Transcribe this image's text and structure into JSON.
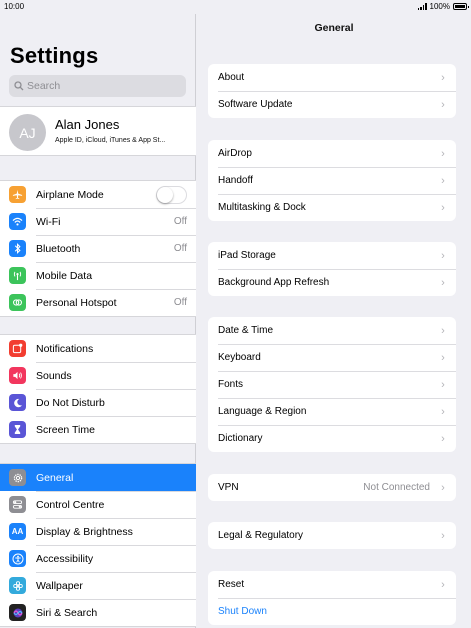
{
  "status": {
    "time": "10:00",
    "battery": "100%"
  },
  "sidebar": {
    "title": "Settings",
    "search_placeholder": "Search",
    "profile": {
      "initials": "AJ",
      "name": "Alan Jones",
      "subtitle": "Apple ID, iCloud, iTunes & App St..."
    },
    "group1": [
      {
        "label": "Airplane Mode",
        "icon": "airplane-icon",
        "color": "#f7a133"
      },
      {
        "label": "Wi-Fi",
        "value": "Off",
        "icon": "wifi-icon",
        "color": "#1a82fb"
      },
      {
        "label": "Bluetooth",
        "value": "Off",
        "icon": "bluetooth-icon",
        "color": "#1a82fb"
      },
      {
        "label": "Mobile Data",
        "icon": "antenna-icon",
        "color": "#3cc45b"
      },
      {
        "label": "Personal Hotspot",
        "value": "Off",
        "icon": "hotspot-icon",
        "color": "#3cc45b"
      }
    ],
    "group2": [
      {
        "label": "Notifications",
        "icon": "notifications-icon",
        "color": "#f23d30"
      },
      {
        "label": "Sounds",
        "icon": "speaker-icon",
        "color": "#f2365e"
      },
      {
        "label": "Do Not Disturb",
        "icon": "moon-icon",
        "color": "#5a55d6"
      },
      {
        "label": "Screen Time",
        "icon": "hourglass-icon",
        "color": "#5a55d6"
      }
    ],
    "group3": [
      {
        "label": "General",
        "icon": "gear-icon",
        "color": "#8e8e93",
        "selected": true
      },
      {
        "label": "Control Centre",
        "icon": "switches-icon",
        "color": "#8e8e93"
      },
      {
        "label": "Display & Brightness",
        "icon": "aa-icon",
        "color": "#1a82fb"
      },
      {
        "label": "Accessibility",
        "icon": "accessibility-icon",
        "color": "#1a82fb"
      },
      {
        "label": "Wallpaper",
        "icon": "flower-icon",
        "color": "#33aadc"
      },
      {
        "label": "Siri & Search",
        "icon": "siri-icon",
        "color": "#222"
      }
    ]
  },
  "detail": {
    "title": "General",
    "groups": [
      [
        {
          "label": "About"
        },
        {
          "label": "Software Update"
        }
      ],
      [
        {
          "label": "AirDrop"
        },
        {
          "label": "Handoff"
        },
        {
          "label": "Multitasking & Dock"
        }
      ],
      [
        {
          "label": "iPad Storage"
        },
        {
          "label": "Background App Refresh"
        }
      ],
      [
        {
          "label": "Date & Time"
        },
        {
          "label": "Keyboard"
        },
        {
          "label": "Fonts"
        },
        {
          "label": "Language & Region"
        },
        {
          "label": "Dictionary"
        }
      ],
      [
        {
          "label": "VPN",
          "value": "Not Connected"
        }
      ],
      [
        {
          "label": "Legal & Regulatory"
        }
      ],
      [
        {
          "label": "Reset"
        },
        {
          "label": "Shut Down",
          "link": true
        }
      ]
    ]
  }
}
